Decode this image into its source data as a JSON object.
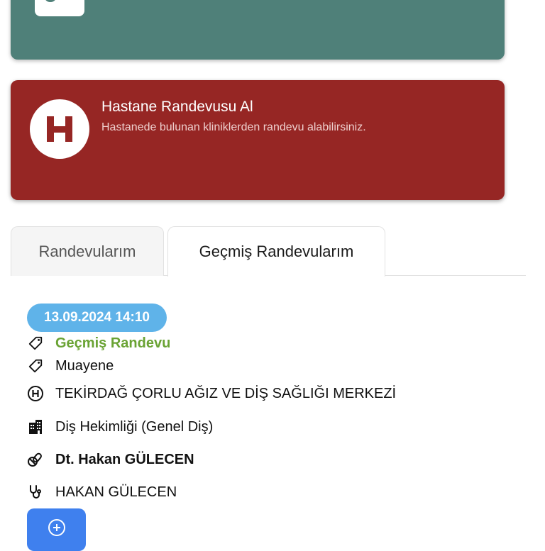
{
  "hospital_card": {
    "title": "Hastane Randevusu Al",
    "subtitle": "Hastanede bulunan kliniklerden randevu alabilirsiniz.",
    "icon": "hospital-h-icon",
    "color": "#962624"
  },
  "top_card": {
    "color": "#4f8079",
    "icon": "glasses-icon"
  },
  "tabs": [
    {
      "label": "Randevularım",
      "active": false
    },
    {
      "label": "Geçmiş Randevularım",
      "active": true
    }
  ],
  "appointment": {
    "datetime": "13.09.2024 14:10",
    "status": "Geçmiş Randevu",
    "type": "Muayene",
    "hospital": "TEKİRDAĞ ÇORLU AĞIZ VE DİŞ SAĞLIĞI MERKEZİ",
    "clinic": "Diş Hekimliği (Genel Diş)",
    "doctor": "Dt. Hakan GÜLECEN",
    "physician": "HAKAN GÜLECEN"
  },
  "colors": {
    "status_green": "#6aa334",
    "badge_blue": "#5fb3e9",
    "fab_blue": "#3f80ee"
  },
  "fab": {
    "icon": "plus-circle-icon"
  }
}
